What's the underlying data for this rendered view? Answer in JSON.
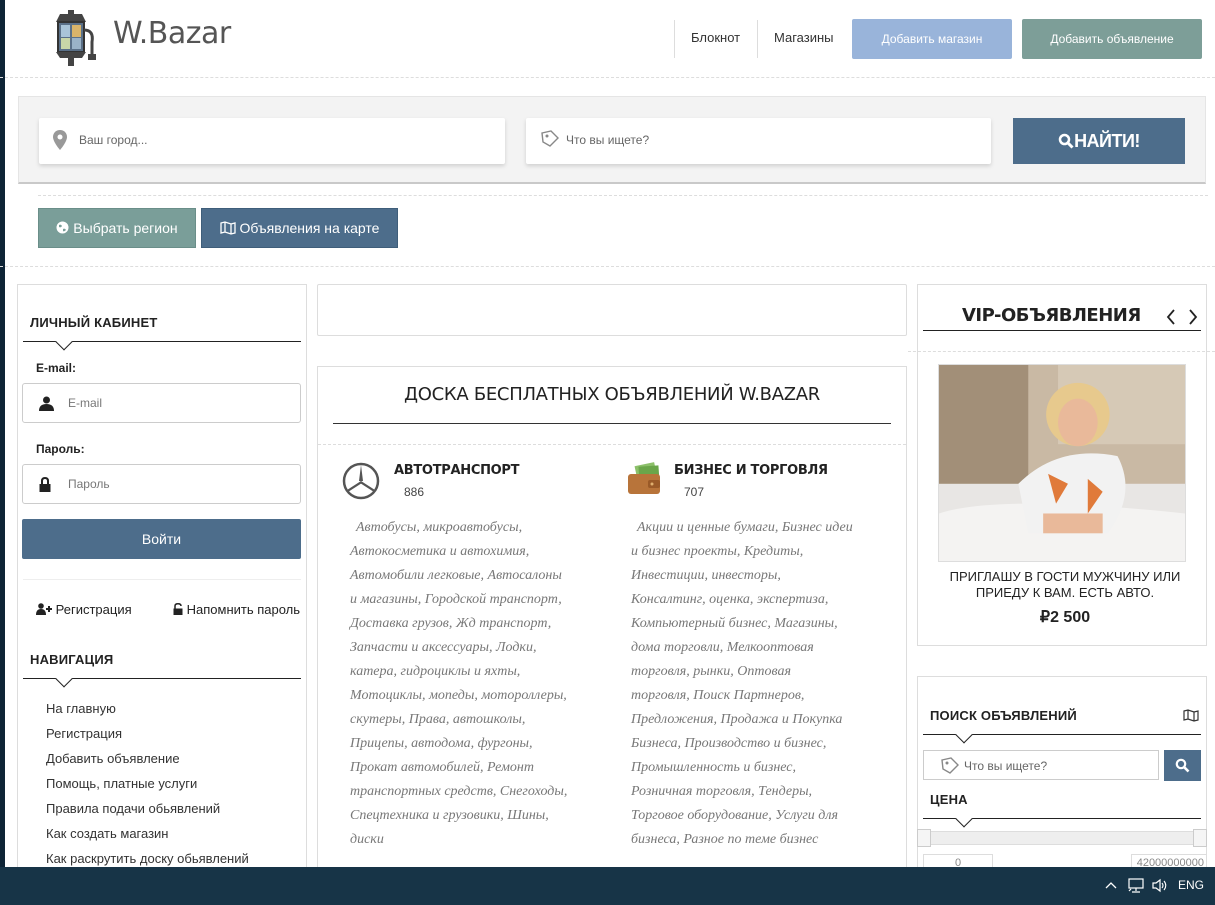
{
  "header": {
    "logo_text": "W.Bazar",
    "nav": [
      "Блокнот",
      "Магазины"
    ],
    "add_shop": "Добавить магазин",
    "add_ad": "Добавить объявление",
    "colors": {
      "add_shop": "#99b4da",
      "add_ad": "#7d9e98"
    }
  },
  "search": {
    "city_placeholder": "Ваш город...",
    "query_placeholder": "Что вы ищете?",
    "find_label": "НАЙТИ!"
  },
  "actions": {
    "region": "Выбрать регион",
    "map": "Объявления на карте"
  },
  "left": {
    "cabinet_title": "ЛИЧНЫЙ КАБИНЕТ",
    "email_label": "E-mail:",
    "email_placeholder": "E-mail",
    "password_label": "Пароль:",
    "password_placeholder": "Пароль",
    "login": "Войти",
    "register": "Регистрация",
    "remind": "Напомнить пароль",
    "nav_title": "НАВИГАЦИЯ",
    "nav_items": [
      "На главную",
      "Регистрация",
      "Добавить объявление",
      "Помощь, платные услуги",
      "Правила подачи обьявлений",
      "Как создать магазин",
      "Как раскрутить доску обьявлений"
    ]
  },
  "center": {
    "board_title": "ДОСКА БЕСПЛАТНЫХ ОБЪЯВЛЕНИЙ W.BAZAR",
    "categories": [
      {
        "title": "АВТОТРАНСПОРТ",
        "count": "886",
        "icon": "mercedes-logo-icon",
        "lines": [
          "Автобусы, микроавтобусы,",
          "Автокосметика и автохимия,",
          "Автомобили легковые, Автосалоны",
          "и магазины, Городской транспорт,",
          "Доставка грузов, Жд транспорт,",
          "Запчасти и аксессуары, Лодки,",
          "катера, гидроциклы и яхты,",
          "Мотоциклы, мопеды, мотороллеры,",
          "скутеры, Права, автошколы,",
          "Прицепы, автодома, фургоны,",
          "Прокат автомобилей, Ремонт",
          "транспортных средств, Снегоходы,",
          "Спецтехника и грузовики, Шины,",
          "диски"
        ]
      },
      {
        "title": "БИЗНЕС И ТОРГОВЛЯ",
        "count": "707",
        "icon": "wallet-money-icon",
        "lines": [
          "Акции и ценные бумаги, Бизнес идеи",
          "и бизнес проекты, Кредиты,",
          "Инвестиции, инвесторы,",
          "Консалтинг, оценка, экспертиза,",
          "Компьютерный бизнес, Магазины,",
          "дома торговли, Мелкооптовая",
          "торговля, рынки, Оптовая",
          "торговля, Поиск Партнеров,",
          "Предложения, Продажа и Покупка",
          "Бизнеса, Производство и бизнес,",
          "Промышленность и бизнес,",
          "Розничная торговля, Тендеры,",
          "Торговое оборудование, Услуги для",
          "бизнеса, Разное по теме бизнес"
        ]
      }
    ]
  },
  "right": {
    "vip_title": "VIP-ОБЪЯВЛЕНИЯ",
    "vip_caption": "ПРИГЛАШУ В ГОСТИ МУЖЧИНУ ИЛИ ПРИЕДУ К ВАМ. ЕСТЬ АВТО.",
    "vip_price": "₽2 500",
    "search_title": "ПОИСК ОБЪЯВЛЕНИЙ",
    "search_placeholder": "Что вы ищете?",
    "price_title": "ЦЕНА",
    "price_min": "0",
    "price_max": "42000000000"
  },
  "taskbar": {
    "lang": "ENG"
  }
}
